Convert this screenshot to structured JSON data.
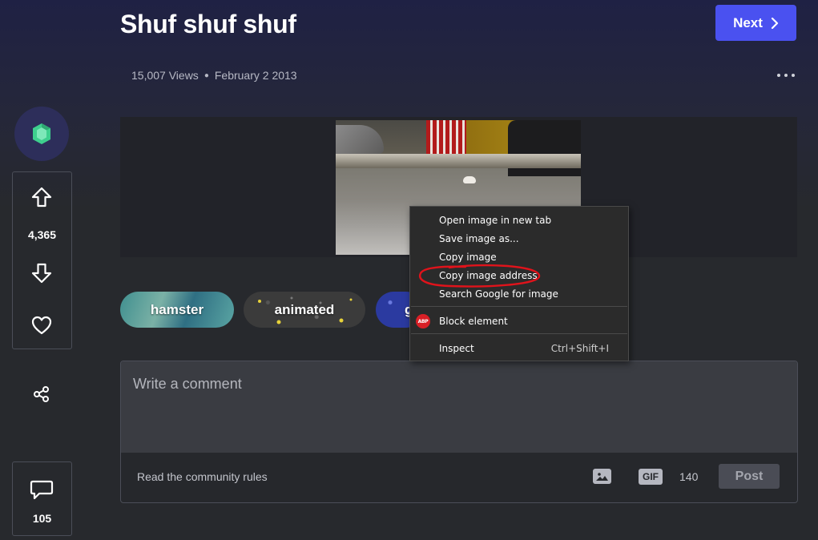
{
  "post": {
    "title": "Shuf shuf shuf",
    "views": "15,007 Views",
    "date": "February 2 2013",
    "next_label": "Next"
  },
  "sidebar": {
    "vote_count": "4,365",
    "comment_count": "105"
  },
  "tags": [
    {
      "label": "hamster"
    },
    {
      "label": "animated"
    },
    {
      "label": "g"
    }
  ],
  "context_menu": {
    "items": [
      {
        "label": "Open image in new tab"
      },
      {
        "label": "Save image as..."
      },
      {
        "label": "Copy image"
      },
      {
        "label": "Copy image address"
      },
      {
        "label": "Search Google for image"
      },
      {
        "label": "Block element",
        "icon_text": "ABP"
      },
      {
        "label": "Inspect",
        "shortcut": "Ctrl+Shift+I"
      }
    ]
  },
  "comment": {
    "placeholder": "Write a comment",
    "rules_link": "Read the community rules",
    "gif_label": "GIF",
    "char_count": "140",
    "post_label": "Post"
  },
  "colors": {
    "accent": "#4a51f0",
    "annotation": "#e0131b",
    "emerald": "#3ecf8e"
  }
}
